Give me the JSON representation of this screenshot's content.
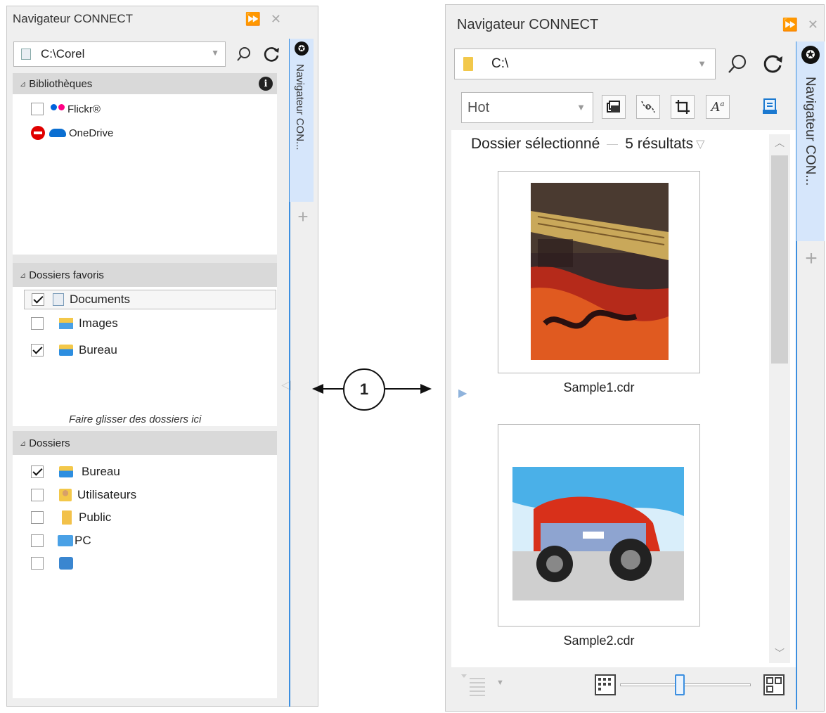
{
  "left_panel": {
    "title": "Navigateur CONNECT",
    "ctrl_expand": "⏩",
    "ctrl_close": "✕",
    "path": "C:\\Corel",
    "side_tab_label": "Navigateur CON...",
    "libraries": {
      "header": "Bibliothèques",
      "items": [
        {
          "label": "Flickr®",
          "checked": false
        },
        {
          "label": "OneDrive",
          "checked": false
        }
      ]
    },
    "favorites": {
      "header": "Dossiers favoris",
      "items": [
        {
          "label": "Documents",
          "checked": true
        },
        {
          "label": "Images",
          "checked": false
        },
        {
          "label": "Bureau",
          "checked": true
        }
      ],
      "hint": "Faire glisser des dossiers ici"
    },
    "folders": {
      "header": "Dossiers",
      "items": [
        {
          "label": "Bureau",
          "checked": true
        },
        {
          "label": "Utilisateurs",
          "checked": false
        },
        {
          "label": "Public",
          "checked": false
        },
        {
          "label": "PC",
          "checked": false
        },
        {
          "label": "",
          "checked": false
        }
      ]
    }
  },
  "annotation": {
    "number": "1"
  },
  "right_panel": {
    "title": "Navigateur CONNECT",
    "ctrl_expand": "⏩",
    "ctrl_close": "✕",
    "path": "C:\\",
    "filter_value": "Hot",
    "side_tab_label": "Navigateur CON...",
    "results_scope": "Dossier sélectionné",
    "results_count": "5 résultats",
    "thumbnails": [
      {
        "label": "Sample1.cdr"
      },
      {
        "label": "Sample2.cdr"
      }
    ]
  },
  "colors": {
    "accent": "#3c8fe0",
    "panel_bg": "#efefef",
    "header_bg": "#d9d9d9"
  },
  "icons": [
    "search-icon",
    "refresh-icon",
    "info-icon",
    "corel-logo-icon",
    "plus-icon",
    "folder-icon",
    "grid-view-icon",
    "large-thumbs-icon",
    "list-view-icon"
  ]
}
